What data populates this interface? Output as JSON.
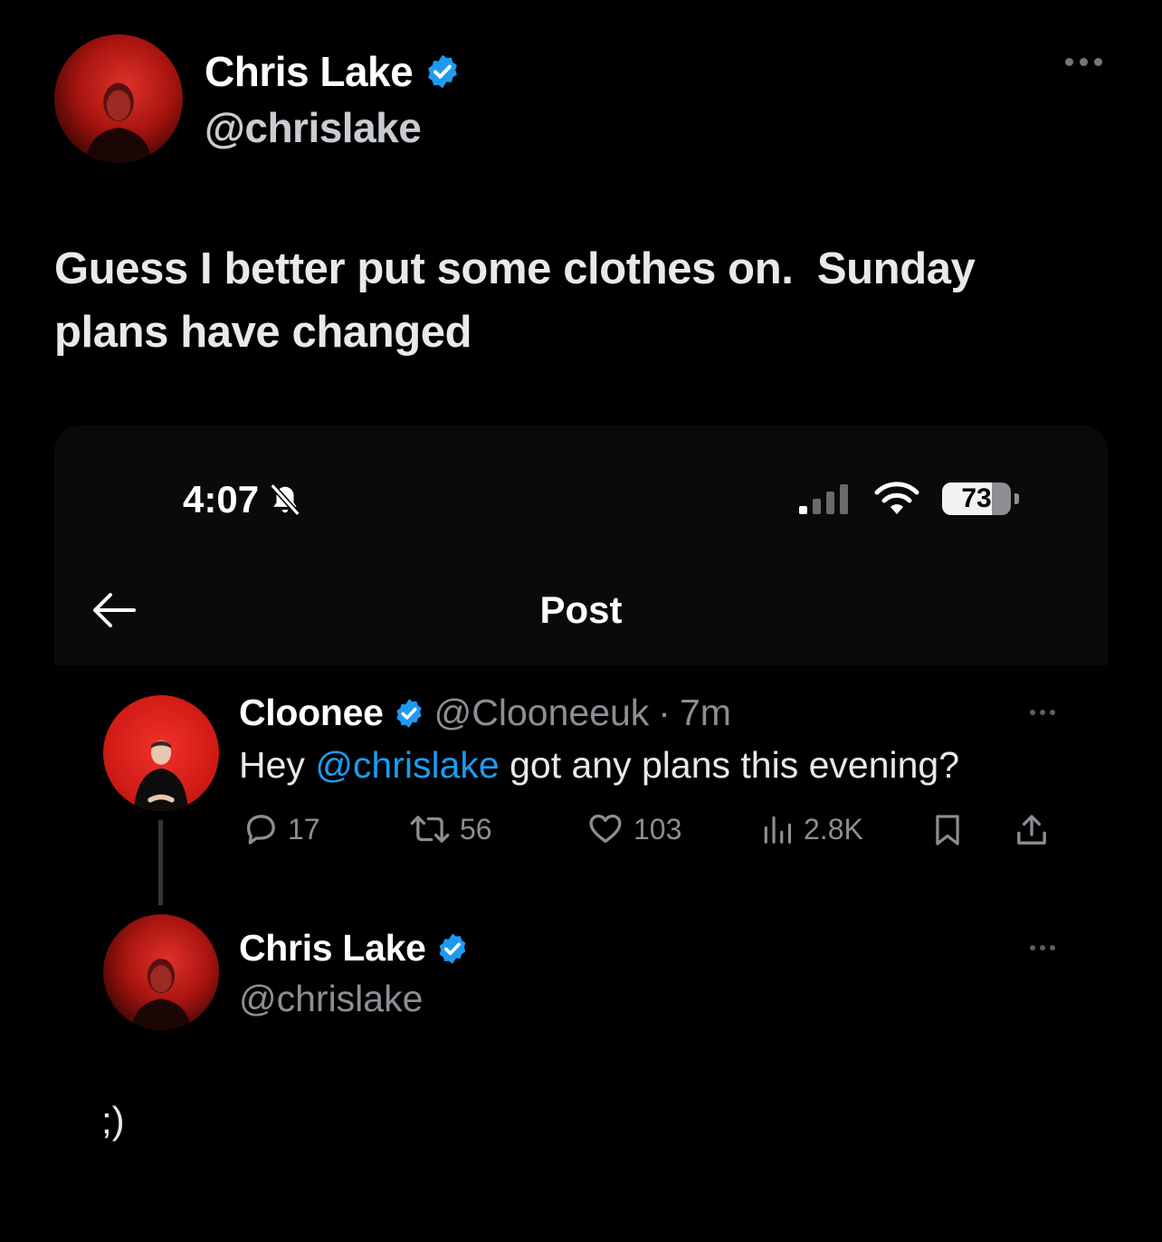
{
  "main_tweet": {
    "author_name": "Chris Lake",
    "author_handle": "@chrislake",
    "verified_icon": "verified-badge-icon",
    "text": "Guess I better put some clothes on.  Sunday\nplans have changed"
  },
  "embedded_screenshot": {
    "status_bar": {
      "time": "4:07",
      "battery_level": "73",
      "icons": [
        "bell-slash-icon",
        "signal-icon",
        "wifi-icon",
        "battery-icon"
      ]
    },
    "header": {
      "title": "Post",
      "back_icon": "back-arrow-icon"
    },
    "reply": {
      "author_name": "Cloonee",
      "author_handle": "@Clooneeuk",
      "separator": "·",
      "time": "7m",
      "text_prefix": "Hey ",
      "mention": "@chrislake",
      "text_suffix": " got any plans this evening?",
      "stats": {
        "replies": "17",
        "reposts": "56",
        "likes": "103",
        "views": "2.8K"
      }
    },
    "response": {
      "author_name": "Chris Lake",
      "author_handle": "@chrislake",
      "text": ";)"
    }
  },
  "colors": {
    "background": "#000000",
    "accent_blue": "#1d9bf0",
    "muted_text": "#8b8f94"
  }
}
